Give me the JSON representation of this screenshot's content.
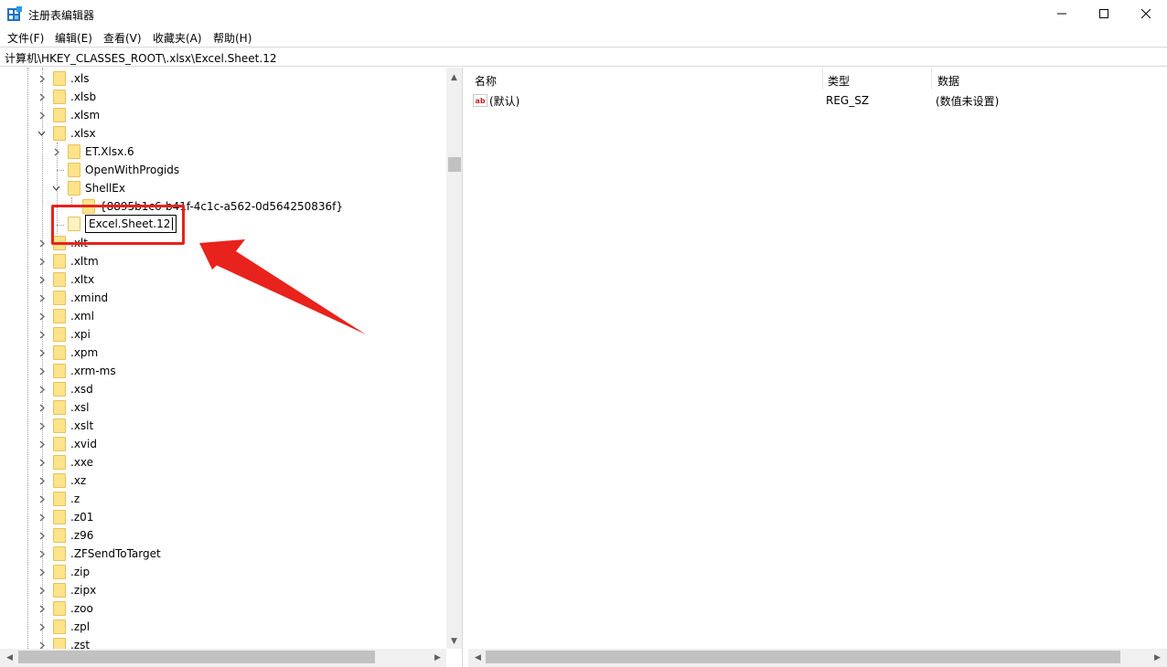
{
  "window": {
    "title": "注册表编辑器",
    "minimize_icon": "minimize-icon",
    "maximize_icon": "maximize-icon",
    "close_icon": "close-icon"
  },
  "menu": {
    "file": "文件(F)",
    "edit": "编辑(E)",
    "view": "查看(V)",
    "favorites": "收藏夹(A)",
    "help": "帮助(H)"
  },
  "address": {
    "path": "计算机\\HKEY_CLASSES_ROOT\\.xlsx\\Excel.Sheet.12"
  },
  "tree": {
    "rows": [
      {
        "label": ".xls"
      },
      {
        "label": ".xlsb"
      },
      {
        "label": ".xlsm"
      },
      {
        "label": ".xlsx"
      },
      {
        "label": "ET.Xlsx.6"
      },
      {
        "label": "OpenWithProgids"
      },
      {
        "label": "ShellEx"
      },
      {
        "label": "{8895b1c6-b41f-4c1c-a562-0d564250836f}"
      },
      {
        "label": "Excel.Sheet.12"
      },
      {
        "label": ".xlt"
      },
      {
        "label": ".xltm"
      },
      {
        "label": ".xltx"
      },
      {
        "label": ".xmind"
      },
      {
        "label": ".xml"
      },
      {
        "label": ".xpi"
      },
      {
        "label": ".xpm"
      },
      {
        "label": ".xrm-ms"
      },
      {
        "label": ".xsd"
      },
      {
        "label": ".xsl"
      },
      {
        "label": ".xslt"
      },
      {
        "label": ".xvid"
      },
      {
        "label": ".xxe"
      },
      {
        "label": ".xz"
      },
      {
        "label": ".z"
      },
      {
        "label": ".z01"
      },
      {
        "label": ".z96"
      },
      {
        "label": ".ZFSendToTarget"
      },
      {
        "label": ".zip"
      },
      {
        "label": ".zipx"
      },
      {
        "label": ".zoo"
      },
      {
        "label": ".zpl"
      },
      {
        "label": ".zst"
      }
    ]
  },
  "values_pane": {
    "columns": {
      "name": "名称",
      "type": "类型",
      "data": "数据"
    },
    "rows": [
      {
        "name": "(默认)",
        "type": "REG_SZ",
        "data": "(数值未设置)",
        "icon": "string-value-icon"
      }
    ]
  },
  "annotation": {
    "color": "#e8221c"
  }
}
